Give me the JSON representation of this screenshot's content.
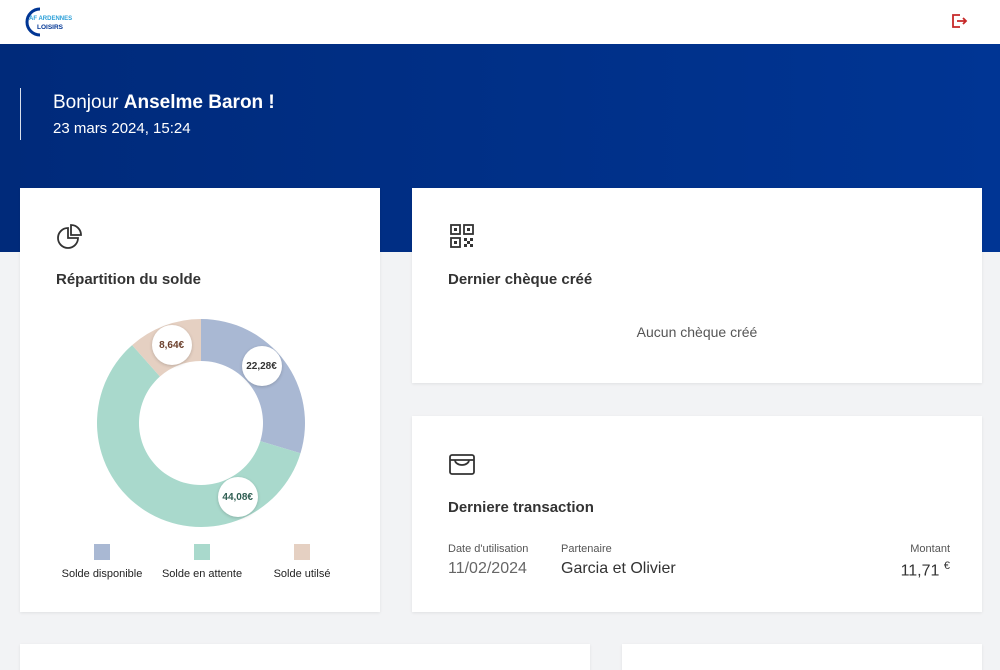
{
  "header": {
    "logo_line1": "AF ARDENNES",
    "logo_line2": "LOISIRS",
    "logout_icon": "logout-icon"
  },
  "hero": {
    "greeting_prefix": "Bonjour ",
    "user_name": "Anselme Baron !",
    "datetime": "23 mars 2024, 15:24"
  },
  "balance_card": {
    "icon": "pie-chart-icon",
    "title": "Répartition du solde",
    "colors": {
      "disponible": "#a9b8d3",
      "en_attente": "#a9d9cc",
      "utilise": "#e5d0c2"
    }
  },
  "chart_data": {
    "type": "pie",
    "categories": [
      "Solde disponible",
      "Solde en attente",
      "Solde utilsé"
    ],
    "values": [
      22.28,
      44.08,
      8.64
    ],
    "value_labels": [
      "22,28€",
      "44,08€",
      "8,64€"
    ],
    "legend_placement": "bottom"
  },
  "cheque_card": {
    "icon": "qr-code-icon",
    "title": "Dernier chèque créé",
    "empty_message": "Aucun chèque créé"
  },
  "transaction_card": {
    "icon": "wallet-icon",
    "title": "Derniere transaction",
    "date_label": "Date d'utilisation",
    "date_value": "11/02/2024",
    "partner_label": "Partenaire",
    "partner_value": "Garcia et Olivier",
    "amount_label": "Montant",
    "amount_value": "11,71",
    "currency": "€"
  }
}
